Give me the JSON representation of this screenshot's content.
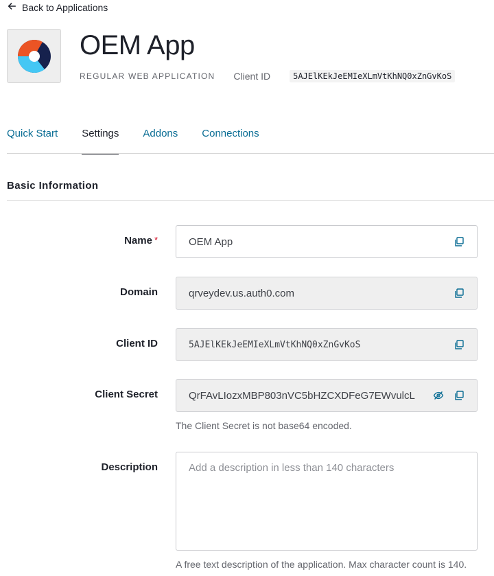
{
  "nav": {
    "back_label": "Back to Applications"
  },
  "app": {
    "title": "OEM App",
    "type_label": "REGULAR WEB APPLICATION",
    "client_id_label": "Client ID",
    "client_id": "5AJElKEkJeEMIeXLmVtKhNQ0xZnGvKoS"
  },
  "tabs": [
    {
      "label": "Quick Start",
      "active": false
    },
    {
      "label": "Settings",
      "active": true
    },
    {
      "label": "Addons",
      "active": false
    },
    {
      "label": "Connections",
      "active": false
    }
  ],
  "section": {
    "title": "Basic Information"
  },
  "fields": {
    "name": {
      "label": "Name",
      "required_mark": "*",
      "value": "OEM App"
    },
    "domain": {
      "label": "Domain",
      "value": "qrveydev.us.auth0.com"
    },
    "client_id": {
      "label": "Client ID",
      "value": "5AJElKEkJeEMIeXLmVtKhNQ0xZnGvKoS"
    },
    "client_secret": {
      "label": "Client Secret",
      "value": "QrFAvLIozxMBP803nVC5bHZCXDFeG7EWvulcL",
      "help": "The Client Secret is not base64 encoded."
    },
    "description": {
      "label": "Description",
      "placeholder": "Add a description in less than 140 characters",
      "help": "A free text description of the application. Max character count is 140."
    }
  },
  "colors": {
    "link": "#0a6d94",
    "required": "#d0021b",
    "text": "#1e212a"
  }
}
